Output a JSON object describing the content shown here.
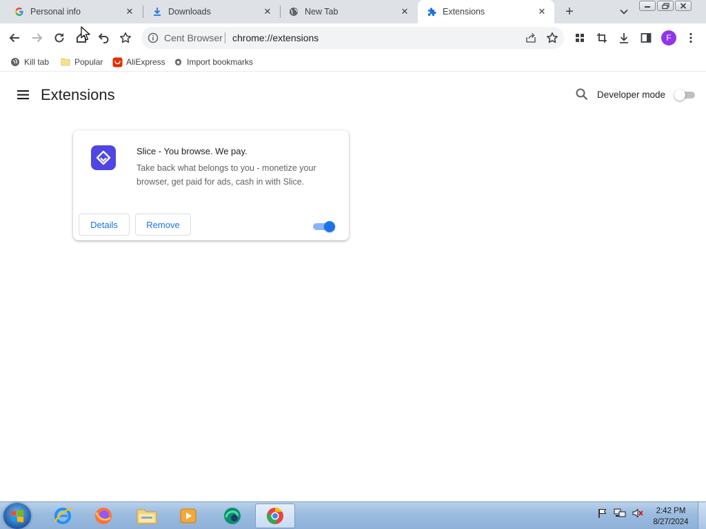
{
  "tabs": [
    {
      "title": "Personal info",
      "icon": "google-icon",
      "active": false
    },
    {
      "title": "Downloads",
      "icon": "download-icon",
      "active": false
    },
    {
      "title": "New Tab",
      "icon": "globe-icon",
      "active": false
    },
    {
      "title": "Extensions",
      "icon": "puzzle-icon",
      "active": true
    }
  ],
  "omnibox": {
    "site_name": "Cent Browser",
    "url": "chrome://extensions"
  },
  "profile": {
    "initial": "F",
    "color": "#9334e6"
  },
  "bookmarks": [
    {
      "label": "Kill tab",
      "icon": "kill-tab-icon"
    },
    {
      "label": "Popular",
      "icon": "folder-icon"
    },
    {
      "label": "AliExpress",
      "icon": "aliexpress-icon"
    },
    {
      "label": "Import bookmarks",
      "icon": "gear-icon"
    }
  ],
  "page": {
    "title": "Extensions"
  },
  "developer_mode": {
    "label": "Developer mode",
    "enabled": false
  },
  "extension": {
    "name": "Slice - You browse. We pay.",
    "description": "Take back what belongs to you - monetize your browser, get paid for ads, cash in with Slice.",
    "details_label": "Details",
    "remove_label": "Remove",
    "enabled": true,
    "icon_color": "#4f46e5"
  },
  "taskbar": {
    "apps": [
      "internet-explorer-icon",
      "firefox-icon",
      "file-explorer-icon",
      "media-player-icon",
      "edge-icon",
      "cent-browser-icon"
    ],
    "time": "2:42 PM",
    "date": "8/27/2024"
  },
  "colors": {
    "accent": "#1a73e8",
    "tabstrip": "#dee1e6",
    "taskbar": "#9bbbe0"
  }
}
